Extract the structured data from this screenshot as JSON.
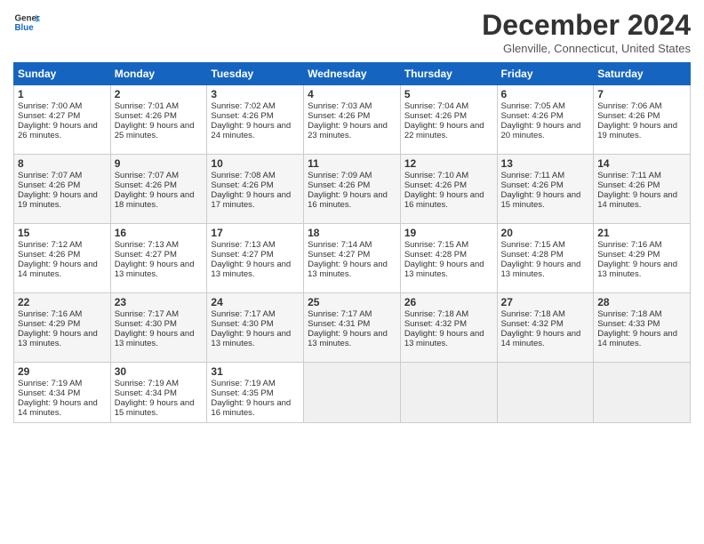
{
  "header": {
    "logo_line1": "General",
    "logo_line2": "Blue",
    "title": "December 2024",
    "location": "Glenville, Connecticut, United States"
  },
  "weekdays": [
    "Sunday",
    "Monday",
    "Tuesday",
    "Wednesday",
    "Thursday",
    "Friday",
    "Saturday"
  ],
  "weeks": [
    [
      {
        "day": "1",
        "sunrise": "7:00 AM",
        "sunset": "4:27 PM",
        "daylight": "9 hours and 26 minutes."
      },
      {
        "day": "2",
        "sunrise": "7:01 AM",
        "sunset": "4:26 PM",
        "daylight": "9 hours and 25 minutes."
      },
      {
        "day": "3",
        "sunrise": "7:02 AM",
        "sunset": "4:26 PM",
        "daylight": "9 hours and 24 minutes."
      },
      {
        "day": "4",
        "sunrise": "7:03 AM",
        "sunset": "4:26 PM",
        "daylight": "9 hours and 23 minutes."
      },
      {
        "day": "5",
        "sunrise": "7:04 AM",
        "sunset": "4:26 PM",
        "daylight": "9 hours and 22 minutes."
      },
      {
        "day": "6",
        "sunrise": "7:05 AM",
        "sunset": "4:26 PM",
        "daylight": "9 hours and 20 minutes."
      },
      {
        "day": "7",
        "sunrise": "7:06 AM",
        "sunset": "4:26 PM",
        "daylight": "9 hours and 19 minutes."
      }
    ],
    [
      {
        "day": "8",
        "sunrise": "7:07 AM",
        "sunset": "4:26 PM",
        "daylight": "9 hours and 19 minutes."
      },
      {
        "day": "9",
        "sunrise": "7:07 AM",
        "sunset": "4:26 PM",
        "daylight": "9 hours and 18 minutes."
      },
      {
        "day": "10",
        "sunrise": "7:08 AM",
        "sunset": "4:26 PM",
        "daylight": "9 hours and 17 minutes."
      },
      {
        "day": "11",
        "sunrise": "7:09 AM",
        "sunset": "4:26 PM",
        "daylight": "9 hours and 16 minutes."
      },
      {
        "day": "12",
        "sunrise": "7:10 AM",
        "sunset": "4:26 PM",
        "daylight": "9 hours and 16 minutes."
      },
      {
        "day": "13",
        "sunrise": "7:11 AM",
        "sunset": "4:26 PM",
        "daylight": "9 hours and 15 minutes."
      },
      {
        "day": "14",
        "sunrise": "7:11 AM",
        "sunset": "4:26 PM",
        "daylight": "9 hours and 14 minutes."
      }
    ],
    [
      {
        "day": "15",
        "sunrise": "7:12 AM",
        "sunset": "4:26 PM",
        "daylight": "9 hours and 14 minutes."
      },
      {
        "day": "16",
        "sunrise": "7:13 AM",
        "sunset": "4:27 PM",
        "daylight": "9 hours and 13 minutes."
      },
      {
        "day": "17",
        "sunrise": "7:13 AM",
        "sunset": "4:27 PM",
        "daylight": "9 hours and 13 minutes."
      },
      {
        "day": "18",
        "sunrise": "7:14 AM",
        "sunset": "4:27 PM",
        "daylight": "9 hours and 13 minutes."
      },
      {
        "day": "19",
        "sunrise": "7:15 AM",
        "sunset": "4:28 PM",
        "daylight": "9 hours and 13 minutes."
      },
      {
        "day": "20",
        "sunrise": "7:15 AM",
        "sunset": "4:28 PM",
        "daylight": "9 hours and 13 minutes."
      },
      {
        "day": "21",
        "sunrise": "7:16 AM",
        "sunset": "4:29 PM",
        "daylight": "9 hours and 13 minutes."
      }
    ],
    [
      {
        "day": "22",
        "sunrise": "7:16 AM",
        "sunset": "4:29 PM",
        "daylight": "9 hours and 13 minutes."
      },
      {
        "day": "23",
        "sunrise": "7:17 AM",
        "sunset": "4:30 PM",
        "daylight": "9 hours and 13 minutes."
      },
      {
        "day": "24",
        "sunrise": "7:17 AM",
        "sunset": "4:30 PM",
        "daylight": "9 hours and 13 minutes."
      },
      {
        "day": "25",
        "sunrise": "7:17 AM",
        "sunset": "4:31 PM",
        "daylight": "9 hours and 13 minutes."
      },
      {
        "day": "26",
        "sunrise": "7:18 AM",
        "sunset": "4:32 PM",
        "daylight": "9 hours and 13 minutes."
      },
      {
        "day": "27",
        "sunrise": "7:18 AM",
        "sunset": "4:32 PM",
        "daylight": "9 hours and 14 minutes."
      },
      {
        "day": "28",
        "sunrise": "7:18 AM",
        "sunset": "4:33 PM",
        "daylight": "9 hours and 14 minutes."
      }
    ],
    [
      {
        "day": "29",
        "sunrise": "7:19 AM",
        "sunset": "4:34 PM",
        "daylight": "9 hours and 14 minutes."
      },
      {
        "day": "30",
        "sunrise": "7:19 AM",
        "sunset": "4:34 PM",
        "daylight": "9 hours and 15 minutes."
      },
      {
        "day": "31",
        "sunrise": "7:19 AM",
        "sunset": "4:35 PM",
        "daylight": "9 hours and 16 minutes."
      },
      null,
      null,
      null,
      null
    ]
  ],
  "labels": {
    "sunrise": "Sunrise:",
    "sunset": "Sunset:",
    "daylight": "Daylight:"
  }
}
